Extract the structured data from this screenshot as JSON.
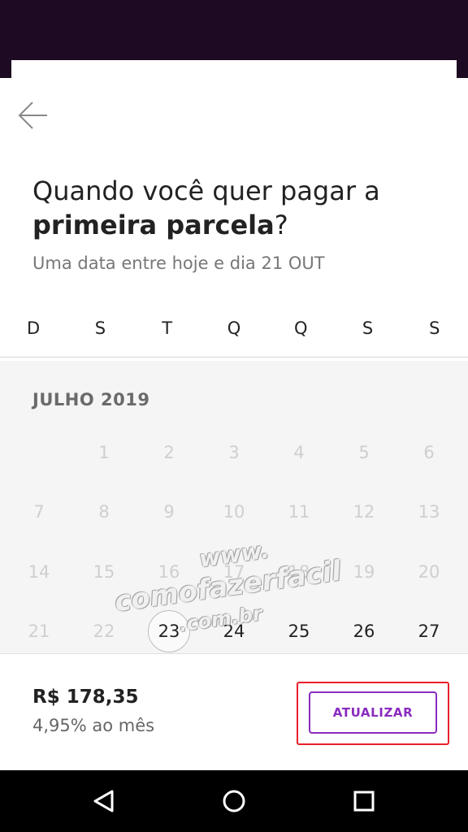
{
  "title": {
    "line1": "Quando você quer pagar a",
    "emphasis": "primeira parcela",
    "suffix": "?"
  },
  "subtitle": "Uma data entre hoje e dia 21 OUT",
  "weekdays": [
    "D",
    "S",
    "T",
    "Q",
    "Q",
    "S",
    "S"
  ],
  "calendar": {
    "month": "JULHO 2019",
    "days": [
      {
        "label": "",
        "state": "empty"
      },
      {
        "label": "1",
        "state": "disabled"
      },
      {
        "label": "2",
        "state": "disabled"
      },
      {
        "label": "3",
        "state": "disabled"
      },
      {
        "label": "4",
        "state": "disabled"
      },
      {
        "label": "5",
        "state": "disabled"
      },
      {
        "label": "6",
        "state": "disabled"
      },
      {
        "label": "7",
        "state": "disabled"
      },
      {
        "label": "8",
        "state": "disabled"
      },
      {
        "label": "9",
        "state": "disabled"
      },
      {
        "label": "10",
        "state": "disabled"
      },
      {
        "label": "11",
        "state": "disabled"
      },
      {
        "label": "12",
        "state": "disabled"
      },
      {
        "label": "13",
        "state": "disabled"
      },
      {
        "label": "14",
        "state": "disabled"
      },
      {
        "label": "15",
        "state": "disabled"
      },
      {
        "label": "16",
        "state": "disabled"
      },
      {
        "label": "17",
        "state": "disabled"
      },
      {
        "label": "18",
        "state": "disabled"
      },
      {
        "label": "19",
        "state": "disabled"
      },
      {
        "label": "20",
        "state": "disabled"
      },
      {
        "label": "21",
        "state": "disabled"
      },
      {
        "label": "22",
        "state": "disabled"
      },
      {
        "label": "23",
        "state": "selected"
      },
      {
        "label": "24",
        "state": "active"
      },
      {
        "label": "25",
        "state": "active"
      },
      {
        "label": "26",
        "state": "active"
      },
      {
        "label": "27",
        "state": "active"
      }
    ]
  },
  "footer": {
    "price": "R$ 178,35",
    "rate": "4,95% ao mês",
    "update_label": "ATUALIZAR"
  },
  "watermark": {
    "line1": "www.",
    "line2": "comofazerfacil",
    "line3": ".com.br"
  },
  "colors": {
    "accent": "#8a2bbf",
    "highlight": "#e8202a",
    "header_bg": "#1e0a22"
  },
  "icons": {
    "back": "arrow-left-icon",
    "nav_back": "triangle-back-icon",
    "nav_home": "circle-home-icon",
    "nav_recent": "square-recent-icon"
  }
}
